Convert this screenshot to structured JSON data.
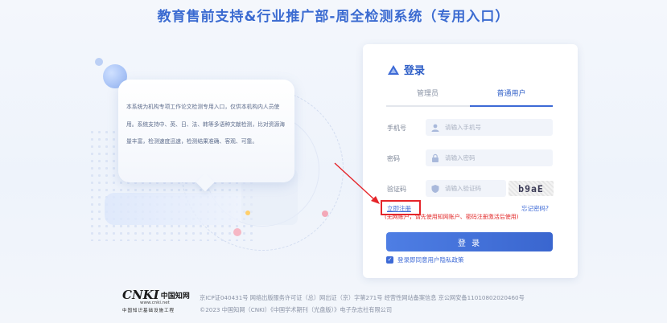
{
  "page": {
    "title": "教育售前支持&行业推广部-周全检测系统（专用入口）"
  },
  "intro": {
    "text": "本系统为机构专项工作论文检测专用入口，仅供本机构内人员使用。系统支持中、英、日、法、韩等多语种文献检测，比对资源海量丰富，检测速度迅速，检测结果准确、客观、可靠。"
  },
  "login": {
    "title": "登录",
    "tabs": [
      {
        "label": "管理员",
        "active": false
      },
      {
        "label": "普通用户",
        "active": true
      }
    ],
    "phone": {
      "label": "手机号",
      "placeholder": "请输入手机号",
      "icon": "user-icon"
    },
    "password": {
      "label": "密码",
      "placeholder": "请输入密码",
      "icon": "lock-icon"
    },
    "captcha": {
      "label": "验证码",
      "placeholder": "请输入验证码",
      "icon": "shield-icon",
      "code": "b9aE"
    },
    "register_label": "立即注册",
    "forgot_label": "忘记密码?",
    "notice": "(无网账户，请先使用知网账户、密码注册激活后使用)",
    "submit_label": "登 录",
    "agree_label": "登录即同意用户隐私政策",
    "agree_checked": true
  },
  "footer": {
    "logo_text": "CNKI",
    "logo_cn": "中国知网",
    "logo_url": "www.cnki.net",
    "logo_sub": "中国知识基础设施工程",
    "line1": "京ICP证040431号 网络出版服务许可证（总）网出证（京）字第271号 经营性网站备案信息 京公网安备11010802020460号",
    "line2": "©2023 中国知网（CNKI）《中国学术期刊（光盘版）》电子杂志社有限公司"
  },
  "colors": {
    "accent": "#3d6ad6",
    "title": "#3b6bd1",
    "highlight": "#e5252a"
  }
}
